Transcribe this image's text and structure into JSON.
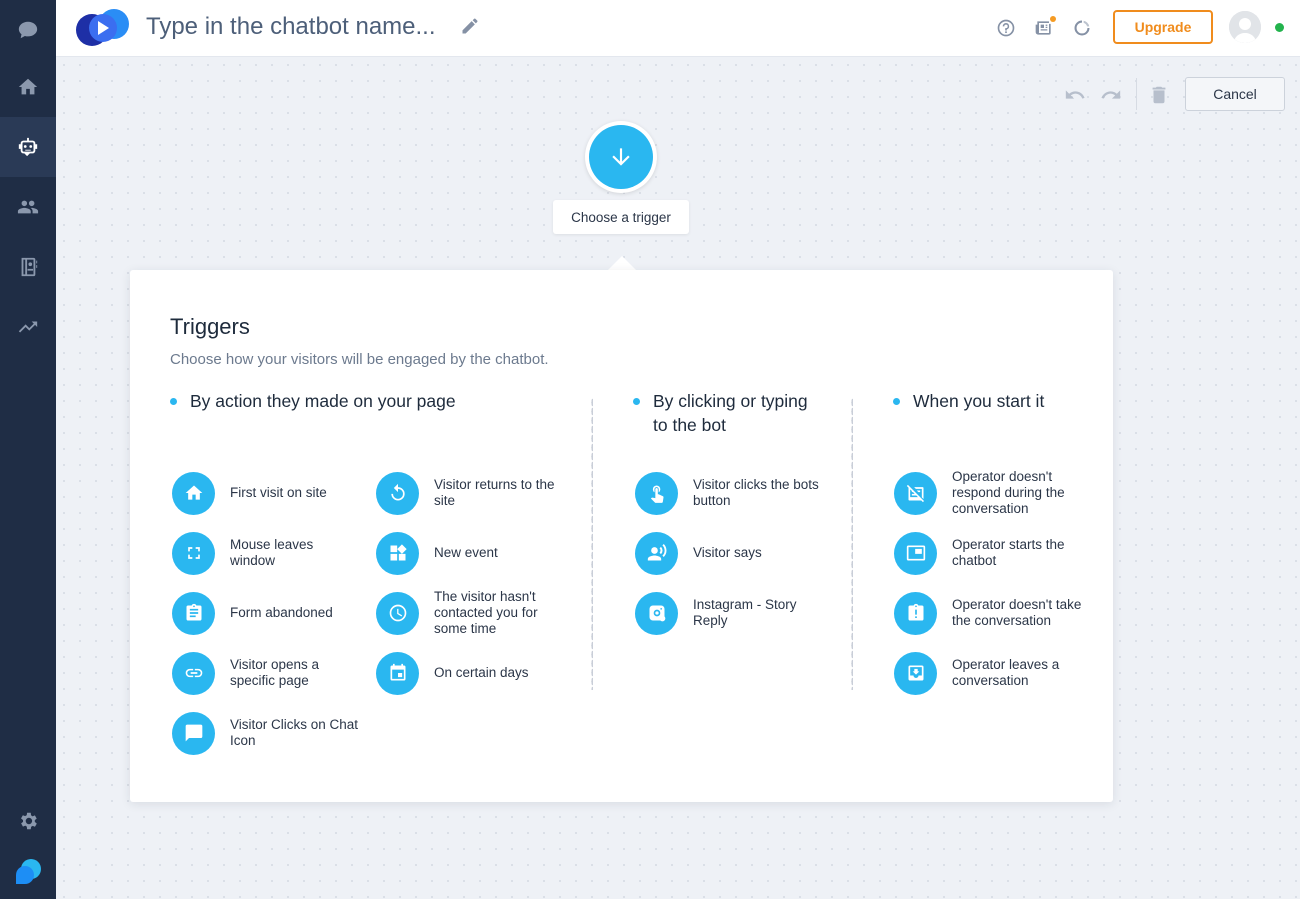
{
  "header": {
    "bot_name_placeholder": "Type in the chatbot name...",
    "upgrade_label": "Upgrade"
  },
  "toolbar": {
    "cancel_label": "Cancel"
  },
  "trigger_node": {
    "label": "Choose a trigger"
  },
  "panel": {
    "title": "Triggers",
    "subtitle": "Choose how your visitors will be engaged by the chatbot.",
    "categories": [
      {
        "title": "By action they made on your page",
        "options": [
          {
            "label": "First visit on site",
            "icon": "home-icon"
          },
          {
            "label": "Visitor returns to the site",
            "icon": "return-icon"
          },
          {
            "label": "Mouse leaves window",
            "icon": "fullscreen-icon"
          },
          {
            "label": "New event",
            "icon": "widgets-icon"
          },
          {
            "label": "Form abandoned",
            "icon": "clipboard-icon"
          },
          {
            "label": "The visitor hasn't contacted you for some time",
            "icon": "clock-icon"
          },
          {
            "label": "Visitor opens a specific page",
            "icon": "link-icon"
          },
          {
            "label": "On certain days",
            "icon": "calendar-icon"
          },
          {
            "label": "Visitor Clicks on Chat Icon",
            "icon": "chat-icon"
          }
        ]
      },
      {
        "title": "By clicking or typing to the bot",
        "options": [
          {
            "label": "Visitor clicks the bots button",
            "icon": "touch-icon"
          },
          {
            "label": "Visitor says",
            "icon": "voice-icon"
          },
          {
            "label": "Instagram - Story Reply",
            "icon": "instagram-icon"
          }
        ]
      },
      {
        "title": "When you start it",
        "options": [
          {
            "label": "Operator doesn't respond during the conversation",
            "icon": "no-reply-icon"
          },
          {
            "label": "Operator starts the chatbot",
            "icon": "window-icon"
          },
          {
            "label": "Operator doesn't take the conversation",
            "icon": "alert-icon"
          },
          {
            "label": "Operator leaves a conversation",
            "icon": "download-tray-icon"
          }
        ]
      }
    ]
  },
  "colors": {
    "sidebar_bg": "#1f2d45",
    "accent": "#2ab7f0",
    "upgrade": "#f08c1d",
    "online": "#23b34d"
  }
}
